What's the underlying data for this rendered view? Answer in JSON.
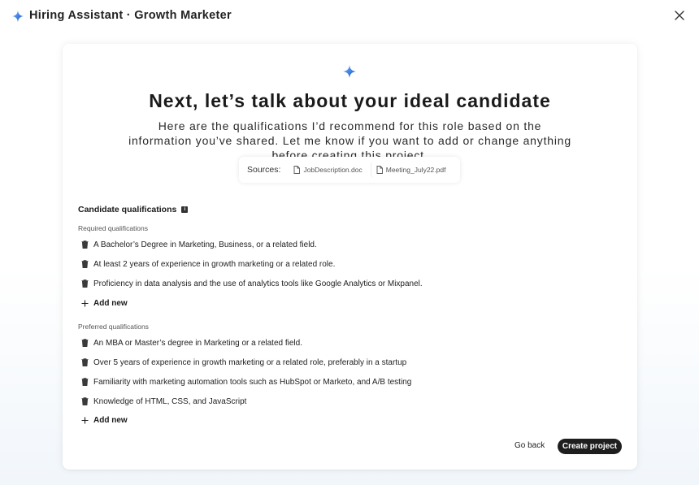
{
  "header": {
    "title": "Hiring Assistant · Growth Marketer",
    "spark_icon": "sparkle-icon",
    "close_icon": "close-icon"
  },
  "main": {
    "headline": "Next, let’s talk about your ideal candidate",
    "subtext": "Here are the qualifications I’d recommend for this role based on the information you’ve shared. Let me know if you want to add or change anything before creating this project.",
    "sources": {
      "label": "Sources:",
      "files": [
        "JobDescription.doc",
        "Meeting_July22.pdf"
      ]
    },
    "qualifications": {
      "title": "Candidate qualifications",
      "required_label": "Required qualifications",
      "required": [
        "A Bachelor’s Degree in Marketing, Business, or a related field.",
        "At least 2 years of experience in growth marketing or a related role.",
        "Proficiency in data analysis and the use of analytics tools like Google Analytics or Mixpanel."
      ],
      "preferred_label": "Preferred qualifications",
      "preferred": [
        "An MBA or Master’s degree in Marketing or a related field.",
        "Over 5 years of experience in growth marketing or a related role, preferably in a startup",
        "Familiarity with marketing automation tools such as HubSpot or Marketo, and A/B testing",
        "Knowledge of HTML, CSS, and JavaScript"
      ],
      "add_new_label": "Add new"
    },
    "actions": {
      "back_label": "Go back",
      "create_label": "Create project"
    }
  },
  "colors": {
    "accent_spark_dark": "#1a56c8",
    "accent_spark_light": "#6fb2ff",
    "primary_button": "#1e1e1e"
  }
}
